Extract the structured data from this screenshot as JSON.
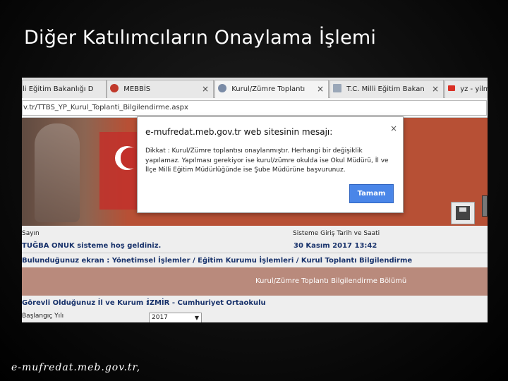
{
  "slide": {
    "title": "Diğer Katılımcıların Onaylama İşlemi",
    "footer": "e-mufredat.meb.gov.tr,"
  },
  "browser": {
    "tabs": [
      {
        "label": "li Eğitim Bakanlığı D",
        "active": false
      },
      {
        "label": "MEBBİS",
        "active": false
      },
      {
        "label": "Kurul/Zümre Toplantı",
        "active": true
      },
      {
        "label": "T.C. Milli Eğitim Bakan",
        "active": false
      },
      {
        "label": "yz - yilm",
        "active": false
      }
    ],
    "close_glyph": "×",
    "address": "v.tr/TTBS_YP_Kurul_Toplanti_Bilgilendirme.aspx"
  },
  "dialog": {
    "title": "e-mufredat.meb.gov.tr web sitesinin mesajı:",
    "close": "×",
    "message": "Dikkat : Kurul/Zümre toplantısı onaylanmıştır. Herhangi bir değişiklik yapılamaz. Yapılması gerekiyor ise kurul/zümre okulda ise Okul Müdürü, İl ve İlçe Milli Eğitim Müdürlüğünde ise Şube Müdürüne başvurunuz.",
    "ok_label": "Tamam"
  },
  "page": {
    "greeting_label": "Sayın",
    "user_greeting": "TUĞBA ONUK sisteme hoş geldiniz.",
    "login_label": "Sisteme Giriş Tarih ve Saati",
    "login_time": "30 Kasım 2017 13:42",
    "breadcrumb": "Bulunduğunuz ekran : Yönetimsel İşlemler / Eğitim Kurumu İşlemleri / Kurul Toplantı Bilgilendirme",
    "section_title": "Kurul/Zümre Toplantı Bilgilendirme Bölümü",
    "duty_label": "Görevli Olduğunuz İl ve Kurum :",
    "duty_value": "İZMİR - Cumhuriyet Ortaokulu",
    "start_year_label": "Başlangıç Yılı",
    "start_year_value": "2017"
  },
  "colors": {
    "dialog_button": "#4a86e8",
    "banner": "#b75035",
    "section_bar": "#b98a7c",
    "link_text": "#18326b"
  }
}
